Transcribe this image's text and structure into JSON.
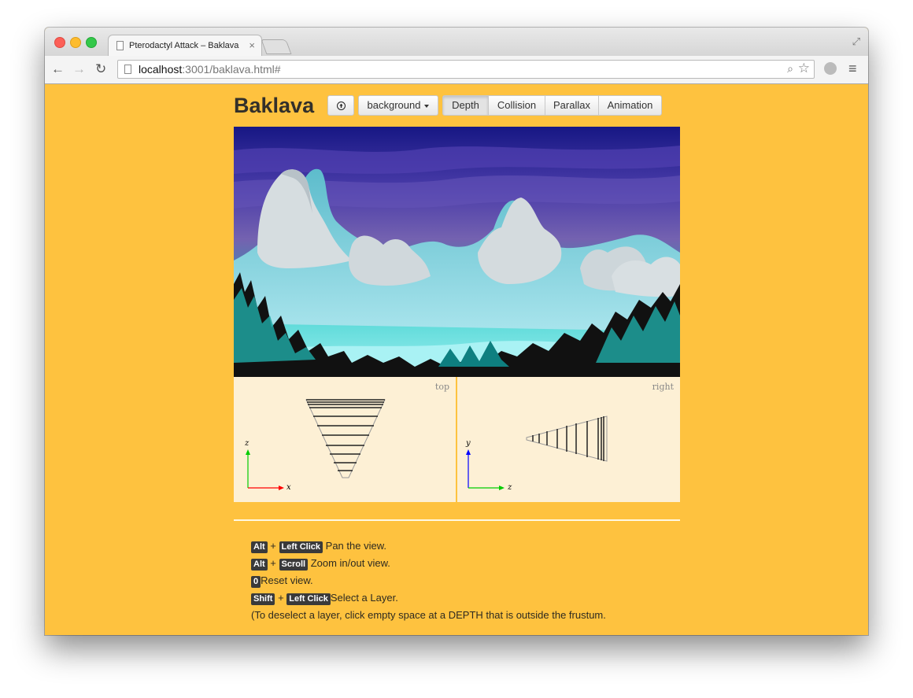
{
  "browser": {
    "tab_title": "Pterodactyl Attack – Baklava",
    "tab_close": "×",
    "url_host": "localhost",
    "url_rest": ":3001/baklava.html#",
    "icons": {
      "back": "←",
      "forward": "→",
      "reload": "↻",
      "zoom": "⌕",
      "star": "☆",
      "menu": "≡",
      "fullscreen": "⤢"
    }
  },
  "app": {
    "brand": "Baklava",
    "layer_select": "background",
    "modes": [
      "Depth",
      "Collision",
      "Parallax",
      "Animation"
    ],
    "active_mode": "Depth"
  },
  "views": {
    "top_label": "top",
    "right_label": "right",
    "top_axes": {
      "vertical": "z",
      "horizontal": "x"
    },
    "right_axes": {
      "vertical": "y",
      "horizontal": "z"
    }
  },
  "help": {
    "line1": {
      "keys": [
        "Alt",
        "Left Click"
      ],
      "text": " Pan the view."
    },
    "line2": {
      "keys": [
        "Alt",
        "Scroll"
      ],
      "text": " Zoom in/out view."
    },
    "line3": {
      "keys": [
        "0"
      ],
      "text": "Reset view."
    },
    "line4": {
      "keys": [
        "Shift",
        "Left Click"
      ],
      "text": "Select a Layer."
    },
    "line5": "(To deselect a layer, click empty space at a DEPTH that is outside the frustum.",
    "plus": "+"
  },
  "colors": {
    "page_bg": "#fec23f",
    "view_bg": "#fdf0d5",
    "axis_x": "#ff0000",
    "axis_green": "#00cc00",
    "axis_y": "#0000ff"
  }
}
